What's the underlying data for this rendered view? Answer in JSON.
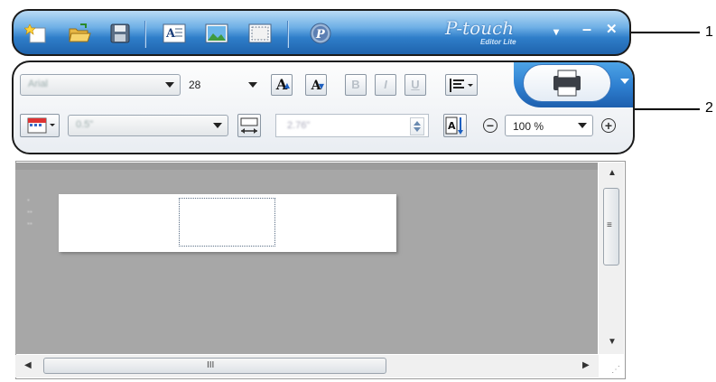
{
  "title_bar": {
    "brand": "P-touch",
    "brand_subtitle": "Editor Lite",
    "icons": [
      "new-icon",
      "open-icon",
      "save-icon",
      "insert-text-icon",
      "insert-image-icon",
      "insert-frame-icon",
      "p-touch-logo-icon"
    ],
    "menu_glyph": "▾",
    "minimize_glyph": "–",
    "close_glyph": "✕"
  },
  "ribbon": {
    "font_name": "Arial",
    "font_size": "28",
    "increase_font_glyph": "A",
    "decrease_font_glyph": "A",
    "bold_glyph": "B",
    "italic_glyph": "I",
    "underline_glyph": "U",
    "label_width_value": "0.5\"",
    "length_value": "2.76\"",
    "zoom_value": "100 %",
    "zoom_out_glyph": "−",
    "zoom_in_glyph": "+"
  },
  "scroll": {
    "h_grip": "III",
    "v_grip": "≡"
  },
  "callouts": [
    "1",
    "2"
  ],
  "colors": {
    "title_bar_blue": "#2f7ec9",
    "canvas_gray": "#a7a7a7",
    "print_button_blue": "#2e7fd0"
  }
}
